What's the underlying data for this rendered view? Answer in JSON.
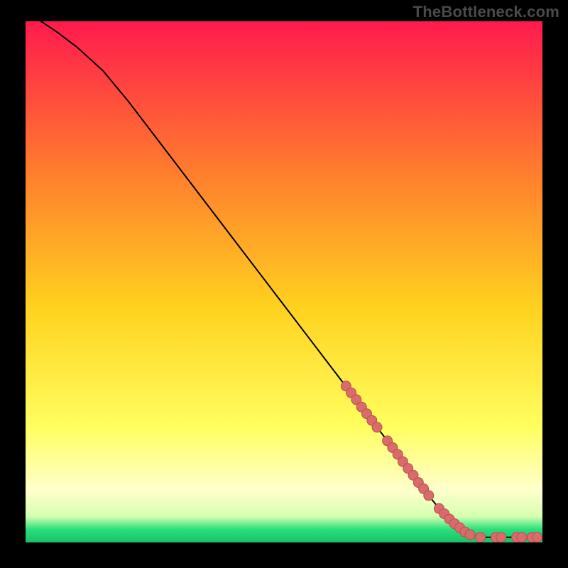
{
  "watermark": "TheBottleneck.com",
  "colors": {
    "background": "#000000",
    "gradient_top": "#ff1a4d",
    "gradient_upper_mid": "#ff7a2e",
    "gradient_mid": "#ffd21f",
    "gradient_lower_mid": "#ffff60",
    "gradient_pale": "#ffffcc",
    "gradient_green": "#28e07a",
    "curve": "#000000",
    "marker_fill": "#da6b6b",
    "marker_stroke": "#b84f4f"
  },
  "chart_data": {
    "type": "line",
    "title": "",
    "xlabel": "",
    "ylabel": "",
    "xlim": [
      0,
      100
    ],
    "ylim": [
      0,
      100
    ],
    "series": [
      {
        "name": "curve",
        "x": [
          3,
          6,
          10,
          15,
          20,
          25,
          30,
          35,
          40,
          45,
          50,
          55,
          60,
          65,
          70,
          73,
          76,
          78,
          80,
          82,
          85,
          88,
          91,
          94,
          97,
          100
        ],
        "y": [
          100,
          98,
          95,
          90.5,
          84.5,
          78,
          71.5,
          65,
          58.5,
          52,
          45.5,
          39,
          32.5,
          26,
          19.5,
          15.5,
          11.5,
          9,
          6.5,
          4.5,
          2,
          1,
          1,
          1,
          1,
          1
        ]
      }
    ],
    "markers": {
      "name": "highlighted-points",
      "x": [
        62,
        63,
        64,
        65,
        66,
        67,
        68,
        70,
        71,
        72,
        73,
        74,
        75,
        76,
        77,
        78,
        80,
        81,
        82,
        83,
        84,
        85,
        86,
        88,
        91,
        92,
        95,
        96,
        98,
        99
      ],
      "y": [
        30,
        28.7,
        27.4,
        26,
        24.7,
        23.4,
        22.1,
        19.5,
        18.2,
        16.9,
        15.5,
        14.2,
        12.9,
        11.5,
        10.3,
        9,
        6.5,
        5.5,
        4.5,
        3.6,
        2.8,
        2,
        1.5,
        1,
        1,
        1,
        1,
        1,
        1,
        1
      ]
    }
  }
}
